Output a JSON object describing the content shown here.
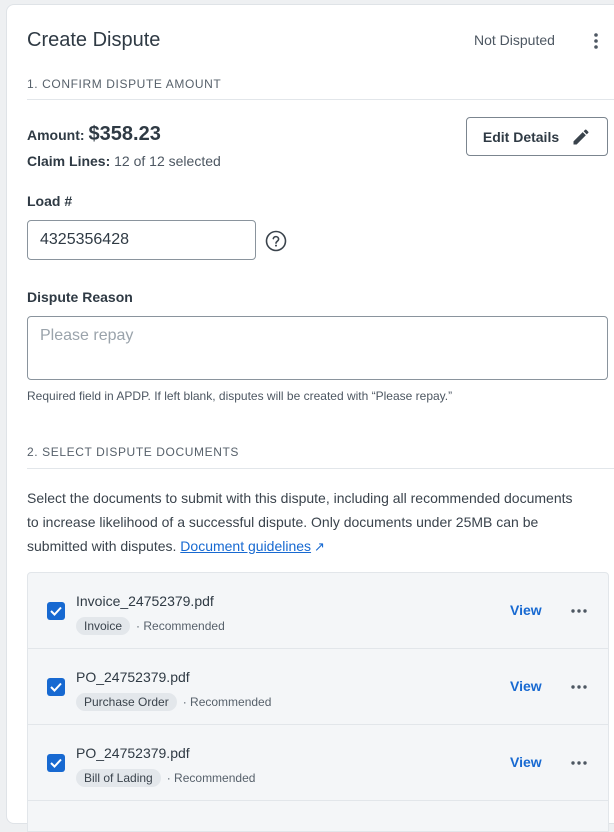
{
  "header": {
    "title": "Create Dispute",
    "status": "Not Disputed",
    "menu_icon": "kebab-vertical-icon"
  },
  "section1": {
    "heading": "1. CONFIRM DISPUTE AMOUNT",
    "amount_label": "Amount:",
    "amount_value": "$358.23",
    "claim_label": "Claim Lines:",
    "claim_value": "12 of 12 selected",
    "edit_button": "Edit Details",
    "edit_icon": "pencil-icon"
  },
  "load": {
    "label": "Load #",
    "value": "4325356428",
    "help_icon": "question-circle-icon"
  },
  "reason": {
    "label": "Dispute Reason",
    "placeholder": "Please repay",
    "hint": "Required field in APDP. If left blank, disputes will be created with “Please repay.”"
  },
  "section2": {
    "heading": "2. SELECT DISPUTE DOCUMENTS",
    "description": "Select the documents to submit with this dispute, including all recommended documents to increase likelihood of a successful dispute. Only documents under 25MB can be submitted with disputes.",
    "link": "Document guidelines",
    "link_icon": "external-link-icon"
  },
  "documents": [
    {
      "name": "Invoice_24752379.pdf",
      "type": "Invoice",
      "note": "· Recommended",
      "action": "View",
      "checked": true
    },
    {
      "name": "PO_24752379.pdf",
      "type": "Purchase Order",
      "note": "· Recommended",
      "action": "View",
      "checked": true
    },
    {
      "name": "PO_24752379.pdf",
      "type": "Bill of Lading",
      "note": "· Recommended",
      "action": "View",
      "checked": true
    }
  ],
  "colors": {
    "accent": "#1769d1",
    "text": "#2f3a44",
    "border": "#8a949d"
  }
}
